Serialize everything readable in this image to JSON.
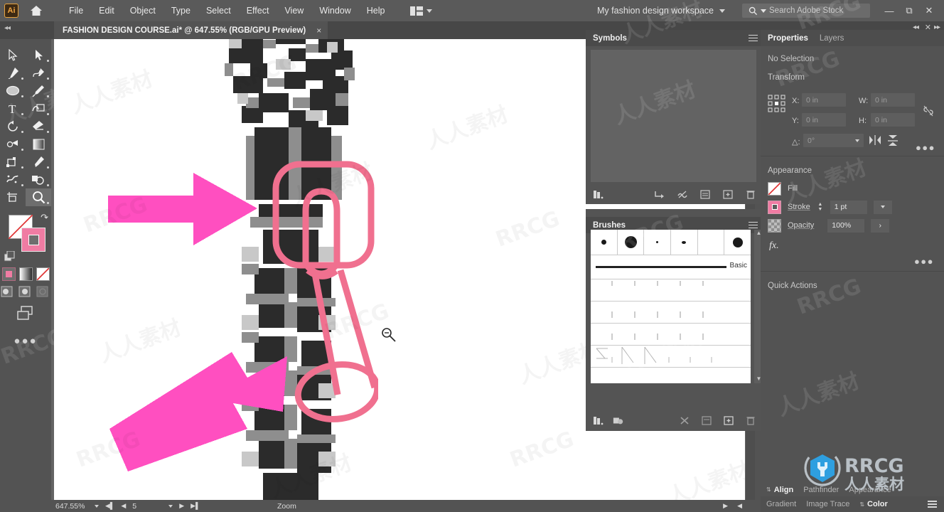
{
  "app": {
    "name": "Adobe Illustrator",
    "logo_text": "Ai",
    "home_icon": "home-icon"
  },
  "menubar": {
    "items": [
      "File",
      "Edit",
      "Object",
      "Type",
      "Select",
      "Effect",
      "View",
      "Window",
      "Help"
    ],
    "arrange_icon": "arrange-documents-icon",
    "workspace": "My fashion design workspace",
    "search_placeholder": "Search Adobe Stock",
    "search_icon": "search-icon",
    "window_buttons": [
      "minimize",
      "restore",
      "close"
    ]
  },
  "document": {
    "tab_title": "FASHION DESIGN COURSE.ai* @ 647.55% (RGB/GPU Preview)",
    "close_label": "×"
  },
  "toolbar": {
    "tools": [
      {
        "name": "selection-tool",
        "selected": false
      },
      {
        "name": "direct-selection-tool",
        "selected": false
      },
      {
        "name": "pen-tool",
        "selected": false
      },
      {
        "name": "curvature-tool",
        "selected": false
      },
      {
        "name": "ellipse-shape-tool",
        "selected": false
      },
      {
        "name": "paintbrush-tool",
        "selected": false
      },
      {
        "name": "type-tool",
        "selected": false
      },
      {
        "name": "shaper-tool",
        "selected": false
      },
      {
        "name": "rotate-tool",
        "selected": false
      },
      {
        "name": "eraser-tool",
        "selected": false
      },
      {
        "name": "scale-tool",
        "selected": false
      },
      {
        "name": "gradient-tool",
        "selected": false
      },
      {
        "name": "free-transform-tool",
        "selected": false
      },
      {
        "name": "eyedropper-tool",
        "selected": false
      },
      {
        "name": "symbol-sprayer-tool",
        "selected": false
      },
      {
        "name": "shape-builder-tool",
        "selected": false
      },
      {
        "name": "artboard-tool",
        "selected": false
      },
      {
        "name": "zoom-tool",
        "selected": true
      }
    ],
    "fill_swatch": "none",
    "stroke_swatch": "#f07ca3",
    "swap_icon": "swap-fill-stroke-icon",
    "default_icon": "default-fill-stroke-icon",
    "paint_modes": [
      "color-mode",
      "gradient-mode",
      "none-mode"
    ],
    "draw_modes": [
      "draw-normal",
      "draw-behind",
      "draw-inside"
    ],
    "screen_mode_icon": "change-screen-mode-icon",
    "more_tools_icon": "edit-toolbar-icon"
  },
  "symbols_panel": {
    "title": "Symbols",
    "menu_icon": "panel-menu-icon",
    "footer_icons": [
      "symbol-libraries-icon",
      "place-symbol-instance-icon",
      "break-link-icon",
      "symbol-options-icon",
      "new-symbol-icon",
      "delete-symbol-icon"
    ]
  },
  "brushes_panel": {
    "title": "Brushes",
    "menu_icon": "panel-menu-icon",
    "basic_label": "Basic",
    "row1_brushes": [
      "5 pt. Round",
      "20 pt. Round",
      "1 pt. Round",
      "3 pt. Round",
      "empty",
      "Charcoal"
    ],
    "footer_icons": [
      "brush-libraries-icon",
      "libraries-panel-icon",
      "remove-brush-stroke-icon",
      "brush-options-icon",
      "new-brush-icon",
      "delete-brush-icon"
    ]
  },
  "properties_panel": {
    "tabs": [
      {
        "label": "Properties",
        "active": true
      },
      {
        "label": "Layers",
        "active": false
      }
    ],
    "selection_status": "No Selection",
    "transform": {
      "title": "Transform",
      "reference_point_icon": "reference-point-icon",
      "x_label": "X:",
      "x_value": "0 in",
      "y_label": "Y:",
      "y_value": "0 in",
      "w_label": "W:",
      "w_value": "0 in",
      "h_label": "H:",
      "h_value": "0 in",
      "angle_label": "△:",
      "angle_value": "0°",
      "link_icon": "constrain-proportions-icon",
      "flip_h_icon": "flip-horizontal-icon",
      "flip_v_icon": "flip-vertical-icon",
      "more_options_icon": "more-options-icon"
    },
    "appearance": {
      "title": "Appearance",
      "fill_label": "Fill",
      "fill_value": "none",
      "stroke_label": "Stroke",
      "stroke_weight": "1 pt",
      "stroke_color": "#f07ca3",
      "opacity_label": "Opacity",
      "opacity_value": "100%",
      "fx_label": "fx.",
      "more_options_icon": "more-options-icon"
    },
    "quick_actions": {
      "title": "Quick Actions"
    }
  },
  "dock_tabs": {
    "row1": [
      {
        "label": "Align",
        "active": true
      },
      {
        "label": "Pathfinder",
        "active": false
      },
      {
        "label": "Appearance",
        "active": false
      }
    ],
    "row2": [
      {
        "label": "Gradient",
        "active": false
      },
      {
        "label": "Image Trace",
        "active": false
      },
      {
        "label": "Color",
        "active": true
      }
    ],
    "menu_icon": "panel-menu-icon"
  },
  "statusbar": {
    "zoom_level": "647.55%",
    "page_number": "5",
    "tool_label": "Zoom",
    "first_icon": "first-page-icon",
    "prev_icon": "previous-page-icon",
    "next_icon": "next-page-icon",
    "last_icon": "last-page-icon"
  },
  "canvas": {
    "artwork_name": "zipper-artwork",
    "zoom_cursor_icon": "zoom-out-cursor-icon",
    "annotations": [
      {
        "name": "pink-arrow-top",
        "color": "#ff4fc0"
      },
      {
        "name": "pink-arrow-bottom",
        "color": "#ff4fc0"
      },
      {
        "name": "pink-rounded-rect-outline",
        "color": "#f0708f"
      },
      {
        "name": "pink-pull-tab-outline",
        "color": "#f0708f"
      },
      {
        "name": "pink-ellipse-outline",
        "color": "#f0708f"
      }
    ]
  },
  "watermark": {
    "text_cn": "人人素材",
    "text_en": "RRCG",
    "logo_name": "rrcg-logo"
  },
  "colors": {
    "chrome_bg": "#535353",
    "panel_bg": "#545454",
    "canvas_bg": "#646464",
    "accent_pink": "#f07ca3",
    "arrow_pink": "#ff4fc0",
    "logo_blue": "#2e9fe0"
  }
}
